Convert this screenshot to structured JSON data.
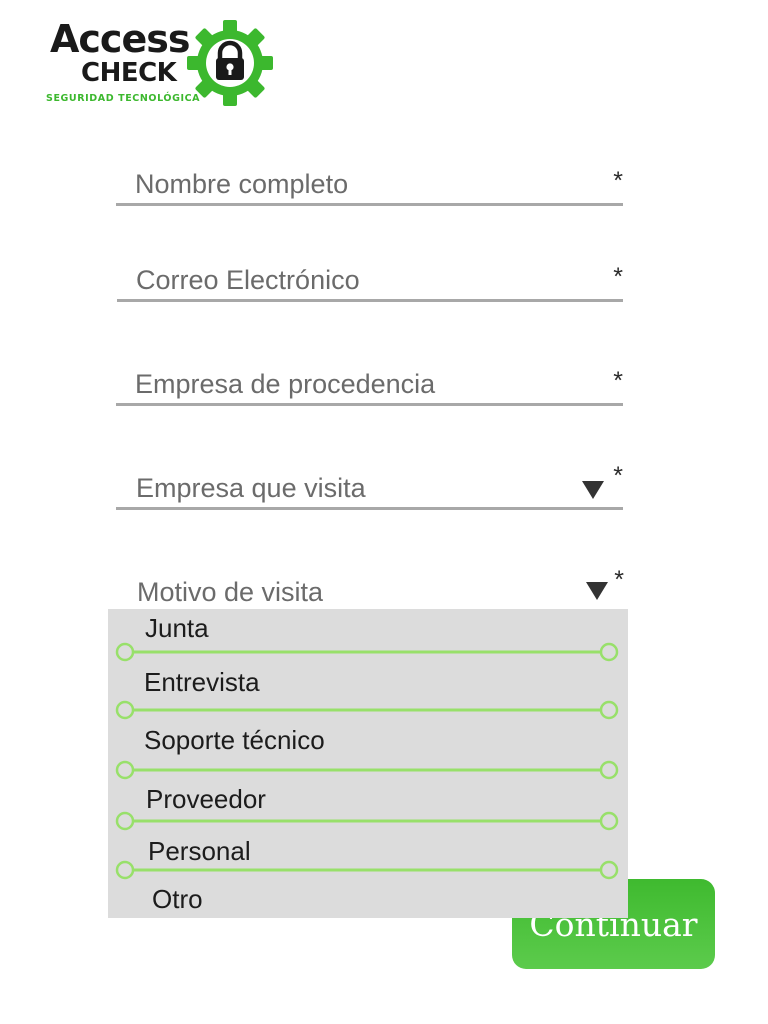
{
  "logo": {
    "line1": "Access",
    "line2": "CHECK",
    "tagline": "SEGURIDAD TECNOLÓGICA",
    "icon": "gear-lock-icon",
    "brand_green": "#3cb82e"
  },
  "form": {
    "required_mark": "*",
    "fields": [
      {
        "label": "Nombre completo"
      },
      {
        "label": "Correo Electrónico"
      },
      {
        "label": "Empresa de procedencia"
      },
      {
        "label": "Empresa que visita",
        "icon": "caret-down-icon"
      }
    ],
    "motivo": {
      "label": "Motivo de visita",
      "icon": "caret-down-icon",
      "options": [
        "Junta",
        "Entrevista",
        "Soporte técnico",
        "Proveedor",
        "Personal",
        "Otro"
      ]
    }
  },
  "continue_label": "Continuar",
  "colors": {
    "dropdown_bg": "#dcdcdc",
    "separator": "#98e06a",
    "button": "#4cc23c",
    "field_line": "#a8a8a8"
  }
}
